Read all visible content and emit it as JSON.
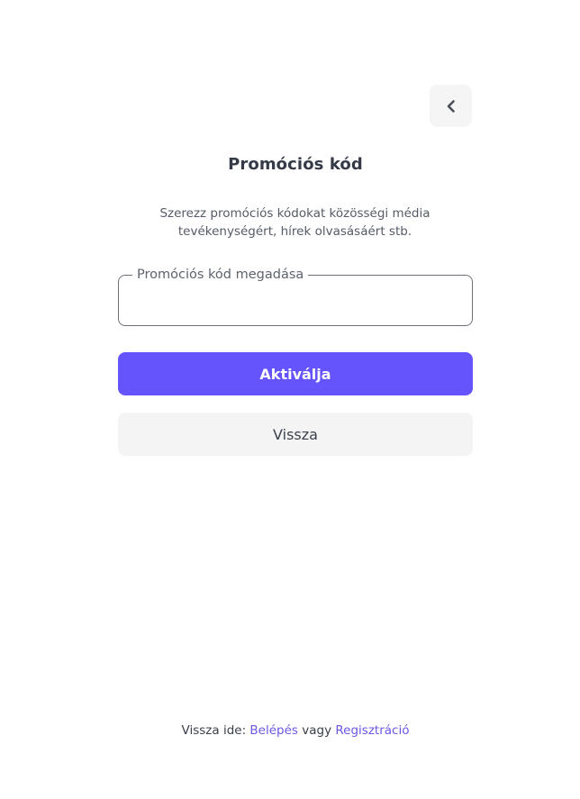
{
  "header": {
    "back_icon": "chevron-left-icon"
  },
  "main": {
    "title": "Promóciós kód",
    "description_line1": "Szerezz promóciós kódokat közösségi média",
    "description_line2": "tevékenységért, hírek olvasásáért stb.",
    "promo_field": {
      "label": "Promóciós kód megadása",
      "value": "",
      "placeholder": ""
    },
    "activate_label": "Aktiválja",
    "back_label": "Vissza"
  },
  "footer": {
    "prefix": "Vissza ide:",
    "login_link": "Belépés",
    "separator": "vagy",
    "register_link": "Regisztráció"
  },
  "colors": {
    "primary": "#6554fb",
    "link": "#6a58e8",
    "secondary_bg": "#f4f4f5",
    "text": "#343b47"
  }
}
